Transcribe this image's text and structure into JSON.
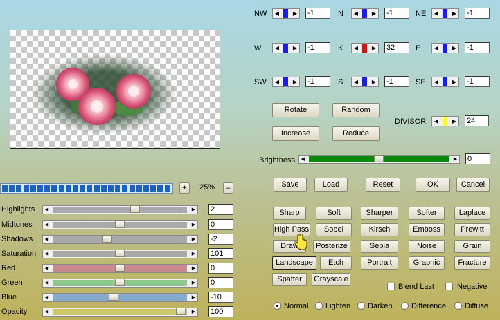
{
  "zoom": {
    "value": "25%",
    "plus": "+",
    "minus": "–"
  },
  "matrix": {
    "nw": {
      "label": "NW",
      "value": "-1"
    },
    "n": {
      "label": "N",
      "value": "-1"
    },
    "ne": {
      "label": "NE",
      "value": "-1"
    },
    "w": {
      "label": "W",
      "value": "-1"
    },
    "k": {
      "label": "K",
      "value": "32"
    },
    "e": {
      "label": "E",
      "value": "-1"
    },
    "sw": {
      "label": "SW",
      "value": "-1"
    },
    "s": {
      "label": "S",
      "value": "-1"
    },
    "se": {
      "label": "SE",
      "value": "-1"
    }
  },
  "divisor": {
    "label": "DIVISOR",
    "value": "24"
  },
  "brightness": {
    "label": "Brightness",
    "value": "0"
  },
  "buttons": {
    "rotate": "Rotate",
    "random": "Random",
    "increase": "Increase",
    "reduce": "Reduce",
    "save": "Save",
    "load": "Load",
    "reset": "Reset",
    "ok": "OK",
    "cancel": "Cancel"
  },
  "presets": {
    "sharp": "Sharp",
    "soft": "Soft",
    "sharper": "Sharper",
    "softer": "Softer",
    "laplace": "Laplace",
    "highpass": "High Pass",
    "sobel": "Sobel",
    "kirsch": "Kirsch",
    "emboss": "Emboss",
    "prewitt": "Prewitt",
    "draw": "Draw",
    "posterize": "Posterize",
    "sepia": "Sepia",
    "noise": "Noise",
    "grain": "Grain",
    "landscape": "Landscape",
    "etch": "Etch",
    "portrait": "Portrait",
    "graphic": "Graphic",
    "fracture": "Fracture",
    "spatter": "Spatter",
    "grayscale": "Grayscale"
  },
  "checks": {
    "blend_last": "Blend Last",
    "negative": "Negative"
  },
  "modes": {
    "normal": "Normal",
    "lighten": "Lighten",
    "darken": "Darken",
    "difference": "Difference",
    "diffuse": "Diffuse",
    "selected": "Normal"
  },
  "adjust": {
    "highlights": {
      "label": "Highlights",
      "value": "2"
    },
    "midtones": {
      "label": "Midtones",
      "value": "0"
    },
    "shadows": {
      "label": "Shadows",
      "value": "-2"
    },
    "saturation": {
      "label": "Saturation",
      "value": "101"
    },
    "red": {
      "label": "Red",
      "value": "0"
    },
    "green": {
      "label": "Green",
      "value": "0"
    },
    "blue": {
      "label": "Blue",
      "value": "-10"
    },
    "opacity": {
      "label": "Opacity",
      "value": "100"
    }
  },
  "colors": {
    "matrix_thumb": "#1a1aff",
    "k_thumb": "#e01010",
    "divisor_thumb": "#ffff30",
    "brightness_track": "#0a8a0a"
  }
}
